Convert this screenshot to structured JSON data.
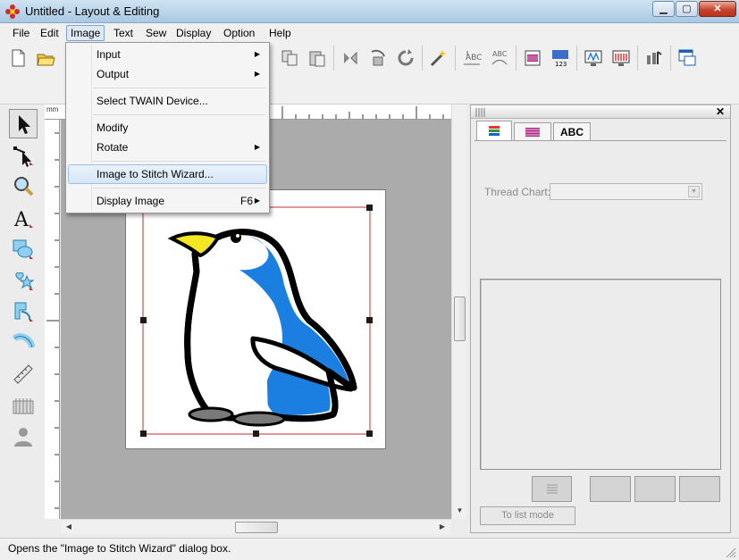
{
  "window": {
    "title": "Untitled - Layout & Editing",
    "min_label": "▁",
    "max_label": "▢",
    "close_label": "✕"
  },
  "menubar": {
    "items": [
      {
        "label": "File"
      },
      {
        "label": "Edit"
      },
      {
        "label": "Image"
      },
      {
        "label": "Text"
      },
      {
        "label": "Sew"
      },
      {
        "label": "Display"
      },
      {
        "label": "Option"
      },
      {
        "label": "Help"
      }
    ],
    "active": "Image"
  },
  "image_menu": {
    "items": [
      {
        "label": "Input",
        "submenu": "▶"
      },
      {
        "label": "Output",
        "submenu": "▶"
      },
      {
        "label": "Select TWAIN Device..."
      },
      {
        "label": "Modify"
      },
      {
        "label": "Rotate",
        "submenu": "▶"
      },
      {
        "label": "Image to Stitch Wizard...",
        "highlighted": true
      },
      {
        "label": "Display Image",
        "accelerator": "F6",
        "submenu": "▶"
      }
    ]
  },
  "ruler": {
    "unit": "mm"
  },
  "panel": {
    "tabs": [
      {
        "icon": "thread-color-icon"
      },
      {
        "icon": "stitch-pattern-icon"
      },
      {
        "label": "ABC"
      }
    ],
    "thread_chart_label": "Thread Chart:",
    "thread_chart_value": "",
    "list_mode_button": "To list mode"
  },
  "status": {
    "text": "Opens the \"Image to Stitch Wizard\" dialog box."
  },
  "colors": {
    "canvas_bg": "#ababab",
    "selection_border": "#c0302c",
    "penguin_blue": "#1a7fe0",
    "beak_yellow": "#f4e623",
    "menu_highlight": "#d6e6f7"
  }
}
